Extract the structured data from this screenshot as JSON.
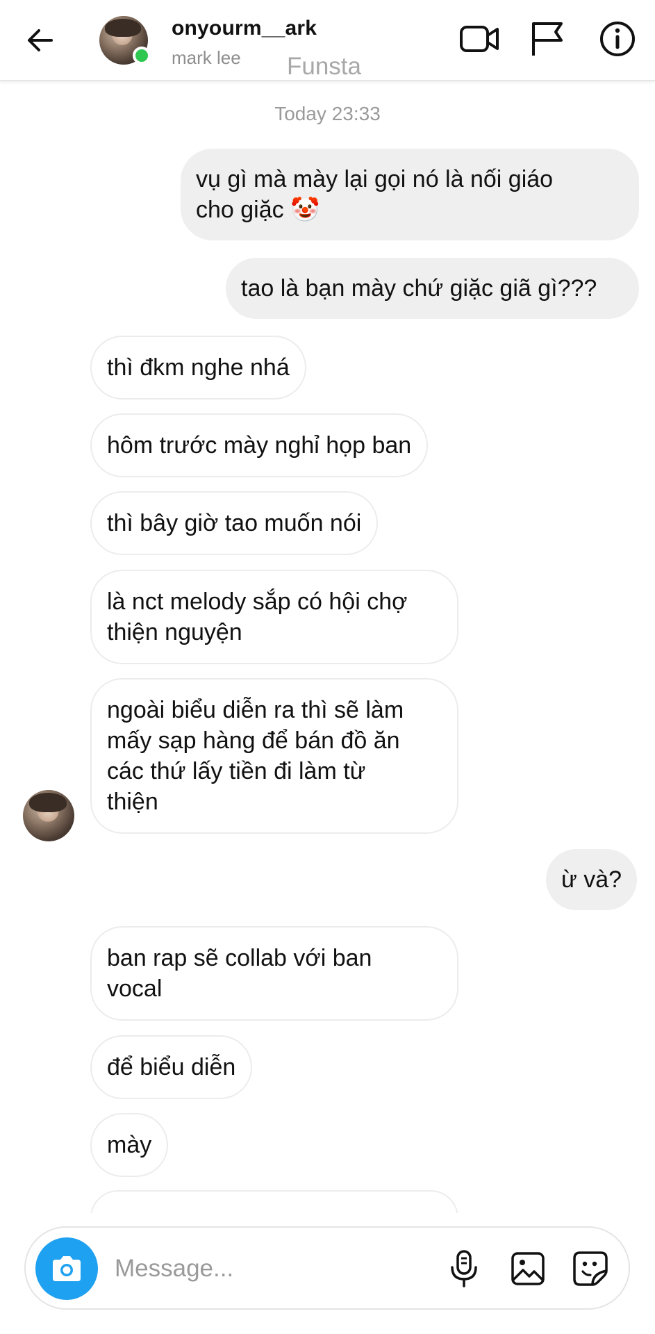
{
  "header": {
    "back_icon": "arrow-left-icon",
    "username": "onyourm__ark",
    "display_name": "mark lee",
    "overlay_label": "Funsta",
    "online_color": "#2ec74f",
    "icons": [
      "video-camera-icon",
      "flag-icon",
      "info-icon"
    ]
  },
  "chat": {
    "timestamp": "Today 23:33",
    "messages": [
      {
        "from": "me",
        "lines": [
          "vụ gì mà mày lại gọi nó là nối giáo",
          "cho giặc 🤡"
        ]
      },
      {
        "from": "me",
        "lines": [
          "tao là bạn mày chứ giặc giã gì???"
        ]
      },
      {
        "from": "them",
        "lines": [
          "thì đkm nghe nhá"
        ]
      },
      {
        "from": "them",
        "lines": [
          "hôm trước mày nghỉ họp ban"
        ]
      },
      {
        "from": "them",
        "lines": [
          "thì bây giờ tao muốn nói"
        ]
      },
      {
        "from": "them",
        "lines": [
          "là nct melody sắp có hội chợ",
          "thiện nguyện"
        ]
      },
      {
        "from": "them",
        "lines": [
          "ngoài biểu diễn ra thì sẽ làm",
          "mấy sạp hàng để bán đồ ăn",
          "các thứ lấy tiền đi làm từ",
          "thiện"
        ]
      },
      {
        "from": "me",
        "lines": [
          "ừ và?"
        ]
      },
      {
        "from": "them",
        "lines": [
          "ban rap sẽ collab với ban",
          "vocal"
        ]
      },
      {
        "from": "them",
        "lines": [
          "để biểu diễn"
        ]
      },
      {
        "from": "them",
        "lines": [
          "mày"
        ]
      }
    ],
    "sent_bubble_color": "#efefef"
  },
  "composer": {
    "placeholder": "Message...",
    "camera_color": "#1fa1f1",
    "icons": [
      "microphone-icon",
      "image-icon",
      "sticker-icon"
    ]
  }
}
